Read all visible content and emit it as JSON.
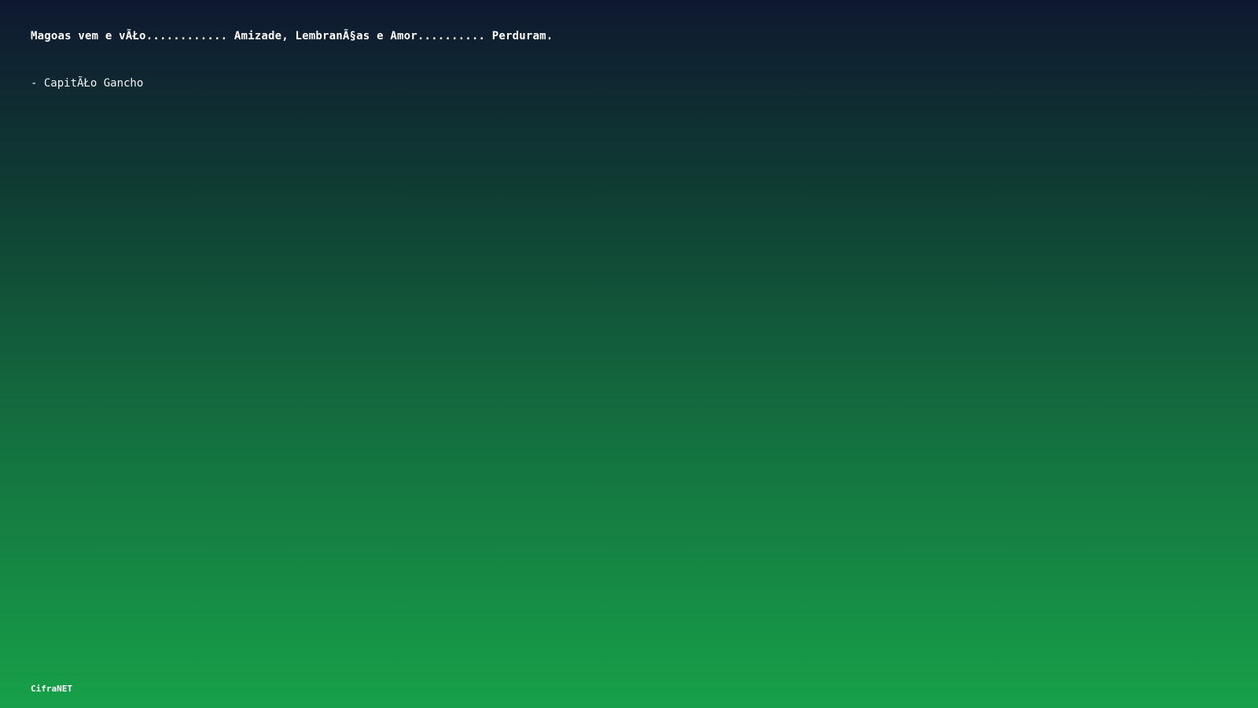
{
  "quote": {
    "text": "Magoas vem e vÃŁo............ Amizade, LembranÃ§as e Amor.......... Perduram.",
    "author": "- CapitÃŁo Gancho"
  },
  "footer": {
    "brand": "CifraNET"
  },
  "colors": {
    "gradient_top": "#0f1830",
    "gradient_bottom": "#17a049",
    "text": "#ffffff"
  }
}
